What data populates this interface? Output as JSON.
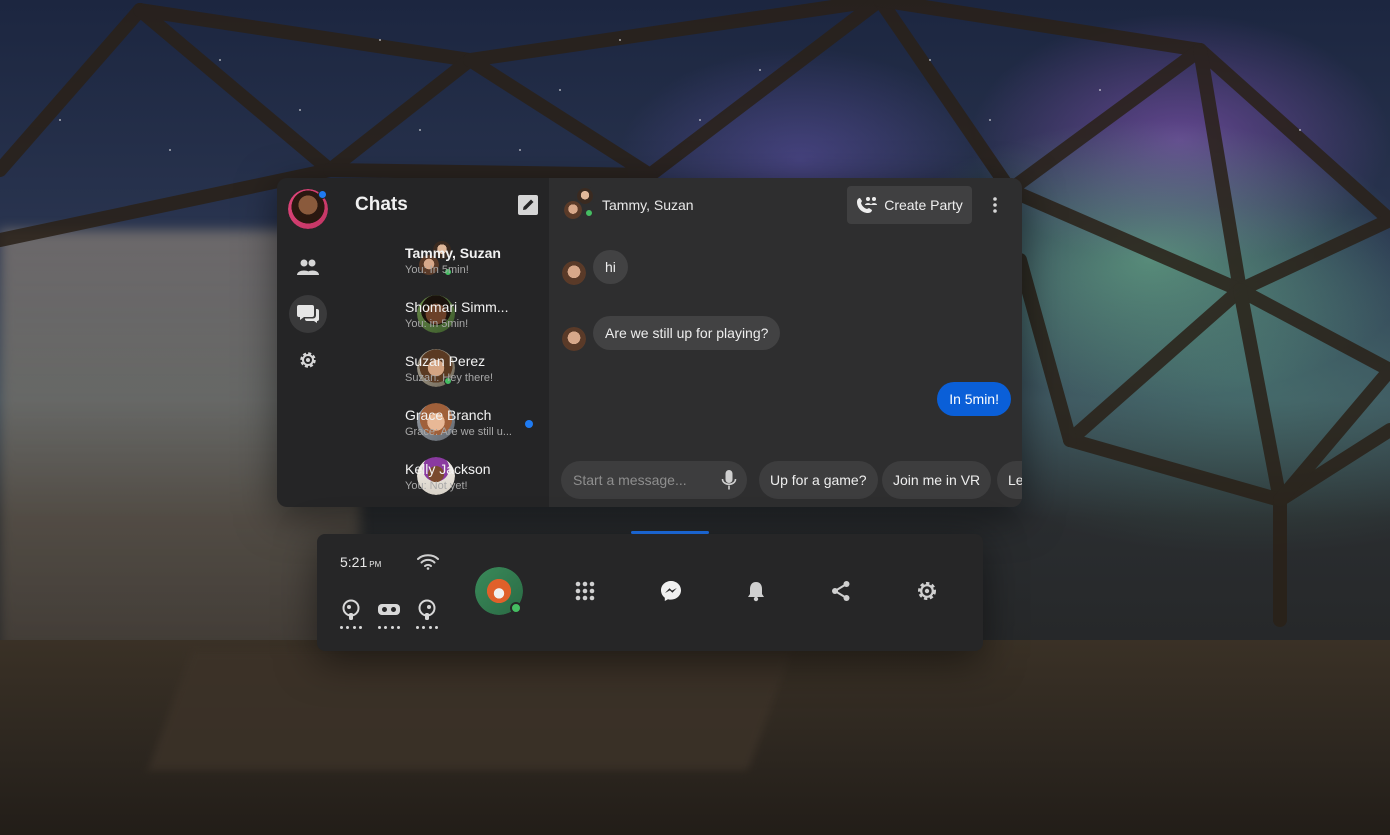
{
  "sidebar": {
    "user_avatar": "user-avatar",
    "items": [
      {
        "icon": "people-icon",
        "label": "People"
      },
      {
        "icon": "chat-icon",
        "label": "Chats"
      },
      {
        "icon": "gear-icon",
        "label": "Settings"
      }
    ]
  },
  "chat_list": {
    "title": "Chats",
    "compose_icon": "compose-icon",
    "items": [
      {
        "name": "Tammy, Suzan",
        "preview": "You: In 5min!",
        "bold": true,
        "online": true,
        "unread": false
      },
      {
        "name": "Shomari Simm...",
        "preview": "You: in 5min!",
        "bold": false,
        "online": false,
        "unread": false
      },
      {
        "name": "Suzan Perez",
        "preview": "Suzan: Hey there!",
        "bold": false,
        "online": true,
        "unread": false
      },
      {
        "name": "Grace Branch",
        "preview": "Grace: Are we still u...",
        "bold": false,
        "online": false,
        "unread": true
      },
      {
        "name": "Kelly Jackson",
        "preview": "You: Not yet!",
        "bold": false,
        "online": false,
        "unread": false
      }
    ]
  },
  "conversation": {
    "title": "Tammy, Suzan",
    "create_party_label": "Create Party",
    "messages": [
      {
        "text": "hi",
        "from_me": false
      },
      {
        "text": "Are we still up for playing?",
        "from_me": false
      },
      {
        "text": "In 5min!",
        "from_me": true
      }
    ],
    "composer_placeholder": "Start a message...",
    "quick_replies": [
      "Up for a game?",
      "Join me in VR",
      "Le"
    ]
  },
  "dock": {
    "time": "5:21",
    "ampm": "PM",
    "icons": [
      "wifi-icon",
      "left-controller-icon",
      "headset-icon",
      "right-controller-icon",
      "profile-avatar",
      "apps-grid-icon",
      "messenger-icon",
      "bell-icon",
      "share-icon",
      "gear-icon"
    ]
  },
  "colors": {
    "accent": "#0a5fd8",
    "online": "#45bd62",
    "panel": "#252526",
    "conversation_bg": "#2e2e2f"
  }
}
